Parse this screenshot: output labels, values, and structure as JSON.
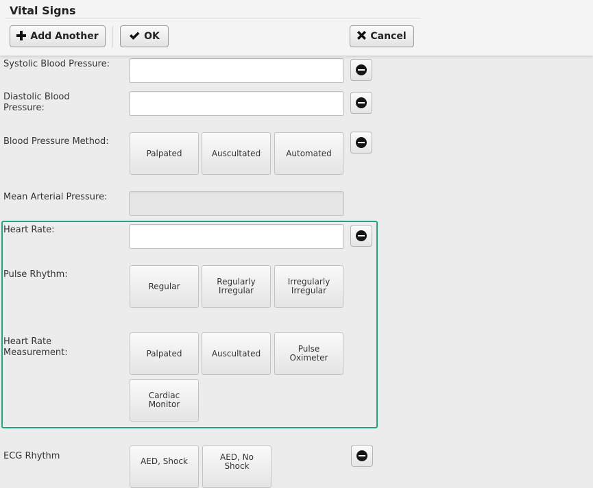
{
  "header": {
    "title": "Vital Signs",
    "add_another_label": "Add Another",
    "ok_label": "OK",
    "cancel_label": "Cancel"
  },
  "fields": {
    "systolic": {
      "label": "Systolic Blood Pressure:",
      "value": ""
    },
    "diastolic": {
      "label": "Diastolic Blood Pressure:",
      "value": ""
    },
    "bp_method": {
      "label": "Blood Pressure Method:",
      "options": [
        "Palpated",
        "Auscultated",
        "Automated"
      ]
    },
    "map": {
      "label": "Mean Arterial Pressure:",
      "value": ""
    },
    "heart_rate": {
      "label": "Heart Rate:",
      "value": ""
    },
    "pulse_rhythm": {
      "label": "Pulse Rhythm:",
      "options": [
        "Regular",
        "Regularly Irregular",
        "Irregularly Irregular"
      ]
    },
    "hr_measurement": {
      "label": "Heart Rate Measurement:",
      "options": [
        "Palpated",
        "Auscultated",
        "Pulse Oximeter",
        "Cardiac Monitor"
      ]
    },
    "ecg_rhythm": {
      "label": "ECG Rhythm",
      "options": [
        "AED, Shock",
        "AED, No Shock"
      ]
    }
  },
  "icons": {
    "add": "plus-icon",
    "ok": "check-icon",
    "cancel": "x-icon",
    "remove": "minus-circle-icon"
  },
  "colors": {
    "highlight": "#1fa484"
  }
}
